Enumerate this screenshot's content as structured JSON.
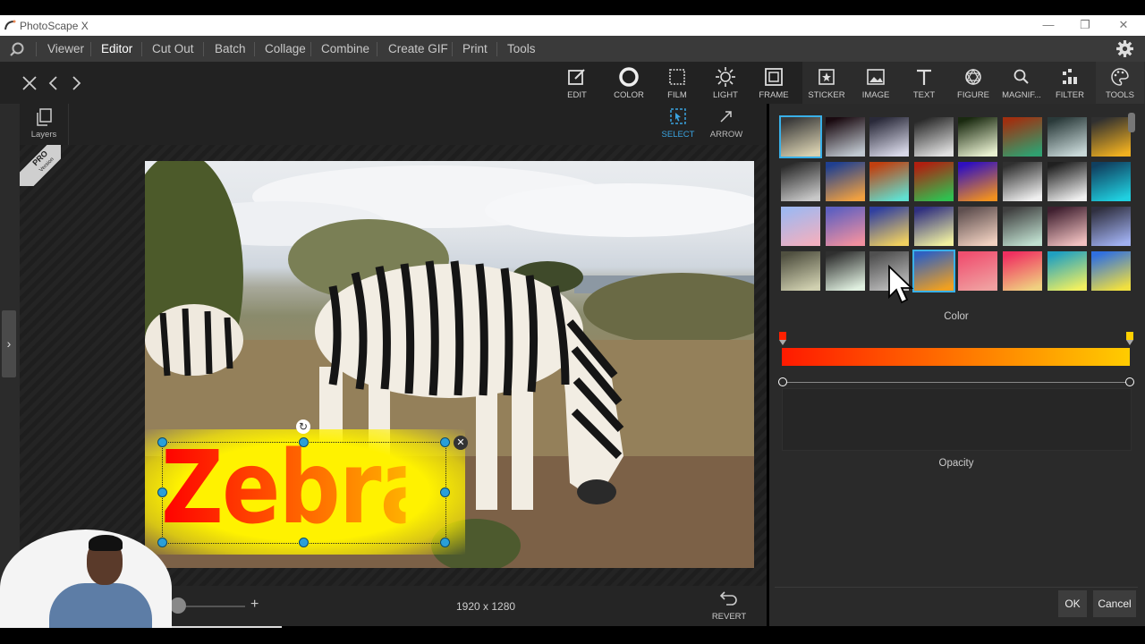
{
  "app": {
    "title": "PhotoScape X",
    "window_buttons": [
      "—",
      "❐",
      "✕"
    ]
  },
  "menu": {
    "items": [
      "Viewer",
      "Editor",
      "Cut Out",
      "Batch",
      "Collage",
      "Combine",
      "Create GIF",
      "Print",
      "Tools"
    ],
    "active": "Editor"
  },
  "toolbar": {
    "tools": [
      {
        "label": "EDIT",
        "icon": "edit-icon"
      },
      {
        "label": "COLOR",
        "icon": "color-icon"
      },
      {
        "label": "FILM",
        "icon": "film-icon"
      },
      {
        "label": "LIGHT",
        "icon": "light-icon"
      },
      {
        "label": "FRAME",
        "icon": "frame-icon"
      },
      {
        "label": "STICKER",
        "icon": "sticker-icon"
      },
      {
        "label": "IMAGE",
        "icon": "image-icon"
      },
      {
        "label": "TEXT",
        "icon": "text-icon"
      },
      {
        "label": "FIGURE",
        "icon": "figure-icon"
      },
      {
        "label": "MAGNIF...",
        "icon": "magnifier-icon"
      },
      {
        "label": "FILTER",
        "icon": "filter-icon"
      },
      {
        "label": "TOOLS",
        "icon": "palette-icon"
      }
    ],
    "active": "TOOLS"
  },
  "subtools": {
    "layers_label": "Layers",
    "select_label": "SELECT",
    "arrow_label": "ARROW",
    "pro_badge": "PRO",
    "pro_badge_sub": "Version"
  },
  "canvas": {
    "text_object": "Zebra",
    "dimensions": "1920 x 1280",
    "revert_label": "REVERT"
  },
  "panel": {
    "color_label": "Color",
    "opacity_label": "Opacity",
    "ok_label": "OK",
    "cancel_label": "Cancel",
    "gradient_start": "#ff1a00",
    "gradient_end": "#ffcc00",
    "swatches": [
      [
        "#3a3a3a",
        "#d8d0b0"
      ],
      [
        "#1a0a10",
        "#c0c8d0"
      ],
      [
        "#2a2a3a",
        "#d8d8e8"
      ],
      [
        "#2a2a2a",
        "#e0e0e0"
      ],
      [
        "#1a2a10",
        "#e8f0d0"
      ],
      [
        "#a03010",
        "#30a070"
      ],
      [
        "#2a3a3a",
        "#c8d8d8"
      ],
      [
        "#303030",
        "#f0b020"
      ],
      [
        "#2a2a2a",
        "#c8c8c8"
      ],
      [
        "#204090",
        "#f0a040"
      ],
      [
        "#c04010",
        "#60e0d0"
      ],
      [
        "#b02010",
        "#30c050"
      ],
      [
        "#3010c0",
        "#f09020"
      ],
      [
        "#303030",
        "#f0f0f0"
      ],
      [
        "#202020",
        "#f0f0f0"
      ],
      [
        "#104060",
        "#20d0e0"
      ],
      [
        "#a0b8f0",
        "#f0b0c0"
      ],
      [
        "#6060c0",
        "#f090a0"
      ],
      [
        "#3040a0",
        "#f0d060"
      ],
      [
        "#303080",
        "#f0f0a0"
      ],
      [
        "#605050",
        "#f0d0c0"
      ],
      [
        "#404040",
        "#c0e0d0"
      ],
      [
        "#402030",
        "#f0c0c0"
      ],
      [
        "#303040",
        "#a0b0f0"
      ],
      [
        "#505040",
        "#d0d0b0"
      ],
      [
        "#303030",
        "#e0f0e0"
      ],
      [
        "#505050",
        "#c0c0c0"
      ],
      [
        "#3060c0",
        "#f0a020"
      ],
      [
        "#f05070",
        "#f0a0a0"
      ],
      [
        "#f03060",
        "#f0d080"
      ],
      [
        "#20a0c0",
        "#f0f060"
      ],
      [
        "#3070e0",
        "#f0e040"
      ]
    ]
  }
}
